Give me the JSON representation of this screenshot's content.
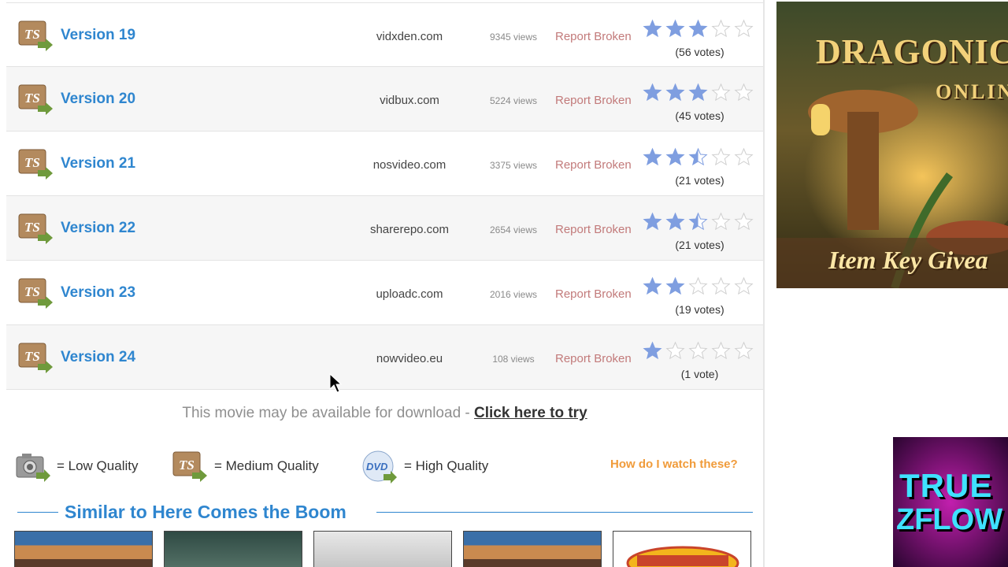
{
  "rows": [
    {
      "version": "Version 19",
      "host": "vidxden.com",
      "views": "9345 views",
      "report": "Report Broken",
      "rating": 3,
      "votes": "(56 votes)"
    },
    {
      "version": "Version 20",
      "host": "vidbux.com",
      "views": "5224 views",
      "report": "Report Broken",
      "rating": 3,
      "votes": "(45 votes)"
    },
    {
      "version": "Version 21",
      "host": "nosvideo.com",
      "views": "3375 views",
      "report": "Report Broken",
      "rating": 2.5,
      "votes": "(21 votes)"
    },
    {
      "version": "Version 22",
      "host": "sharerepo.com",
      "views": "2654 views",
      "report": "Report Broken",
      "rating": 2.5,
      "votes": "(21 votes)"
    },
    {
      "version": "Version 23",
      "host": "uploadc.com",
      "views": "2016 views",
      "report": "Report Broken",
      "rating": 2,
      "votes": "(19 votes)"
    },
    {
      "version": "Version 24",
      "host": "nowvideo.eu",
      "views": "108 views",
      "report": "Report Broken",
      "rating": 1,
      "votes": "(1 vote)"
    }
  ],
  "download": {
    "prefix": "This movie may be available for download - ",
    "link": "Click here to try"
  },
  "legend": {
    "low": "= Low Quality",
    "medium": "= Medium Quality",
    "high": "= High Quality",
    "howto": "How do I watch these?"
  },
  "similar": {
    "title": "Similar to Here Comes the Boom"
  },
  "ad": {
    "title_line1": "DRAGONIC",
    "title_line2": "ONLIN",
    "tagline": "Item Key Givea"
  },
  "watermark": {
    "line1": "TRUE",
    "line2": "ZFLOW"
  },
  "colors": {
    "link_blue": "#2f86cf",
    "star_blue": "#7f9ee0",
    "report_red": "#c27a7a",
    "orange": "#f09b3a"
  }
}
